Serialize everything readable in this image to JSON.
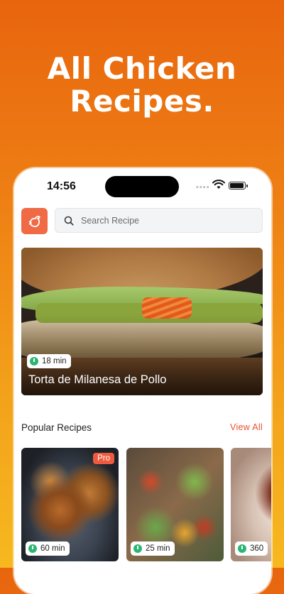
{
  "promo": {
    "headline_line1": "All Chicken",
    "headline_line2": "Recipes."
  },
  "status_bar": {
    "time": "14:56"
  },
  "search": {
    "placeholder": "Search Recipe"
  },
  "featured": {
    "title": "Torta de Milanesa de Pollo",
    "time": "18 min"
  },
  "popular": {
    "section_title": "Popular Recipes",
    "view_all_label": "View All",
    "items": [
      {
        "time": "60 min",
        "badge": "Pro"
      },
      {
        "time": "25 min"
      },
      {
        "time": "360"
      }
    ]
  },
  "colors": {
    "accent": "#ef6a45",
    "link": "#e8502d",
    "timer_green": "#2bb673"
  }
}
